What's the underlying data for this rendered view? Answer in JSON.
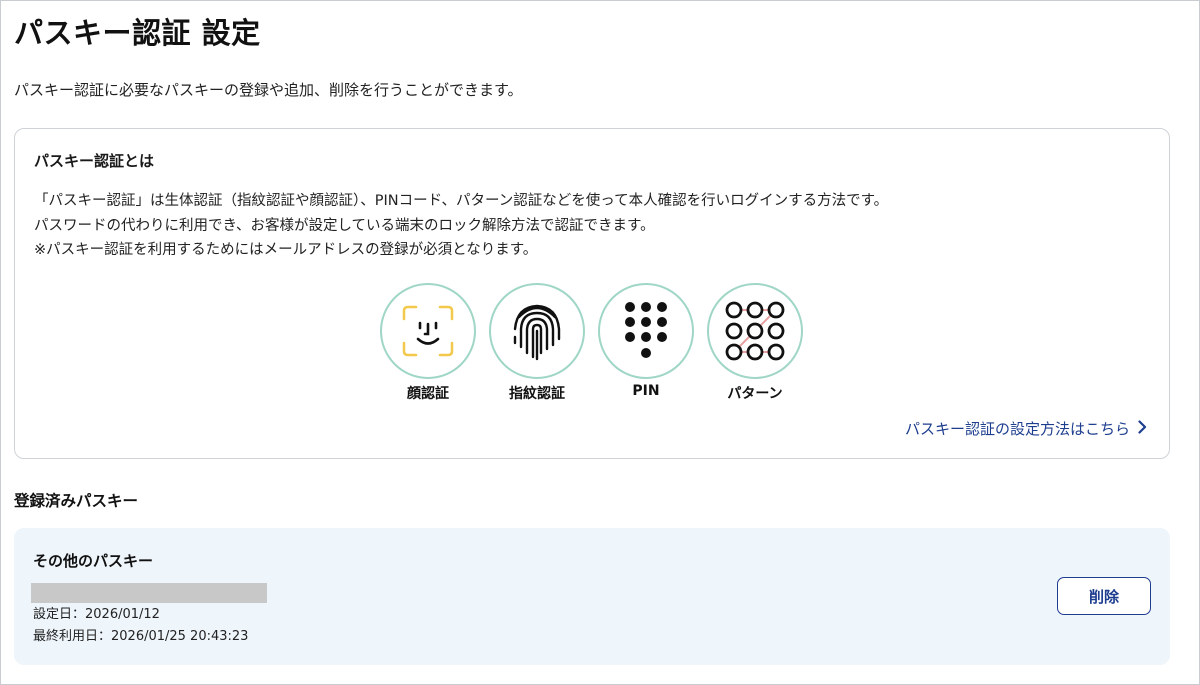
{
  "page": {
    "title": "パスキー認証 設定",
    "description": "パスキー認証に必要なパスキーの登録や追加、削除を行うことができます。"
  },
  "info": {
    "title": "パスキー認証とは",
    "lines": [
      "「パスキー認証」は生体認証（指紋認証や顔認証）、PINコード、パターン認証などを使って本人確認を行いログインする方法です。",
      "パスワードの代わりに利用でき、お客様が設定している端末のロック解除方法で認証できます。",
      "※パスキー認証を利用するためにはメールアドレスの登録が必須となります。"
    ],
    "methods": [
      {
        "label": "顔認証",
        "icon": "face-id-icon"
      },
      {
        "label": "指紋認証",
        "icon": "fingerprint-icon"
      },
      {
        "label": "PIN",
        "icon": "pin-keypad-icon"
      },
      {
        "label": "パターン",
        "icon": "pattern-lock-icon"
      }
    ],
    "link_label": "パスキー認証の設定方法はこちら",
    "link_icon": "chevron-right-icon"
  },
  "registered": {
    "section_title": "登録済みパスキー",
    "items": [
      {
        "name": "その他のパスキー",
        "set_date": "設定日：2026/01/12",
        "last_used": "最終利用日：2026/01/25 20:43:23",
        "delete_label": "削除"
      }
    ]
  },
  "colors": {
    "accent": "#1d3d8f",
    "icon_ring": "#9fd6c6",
    "face_frame": "#f2c94c",
    "pattern_line": "#e8a0a0",
    "card_bg": "#eef5fb"
  }
}
